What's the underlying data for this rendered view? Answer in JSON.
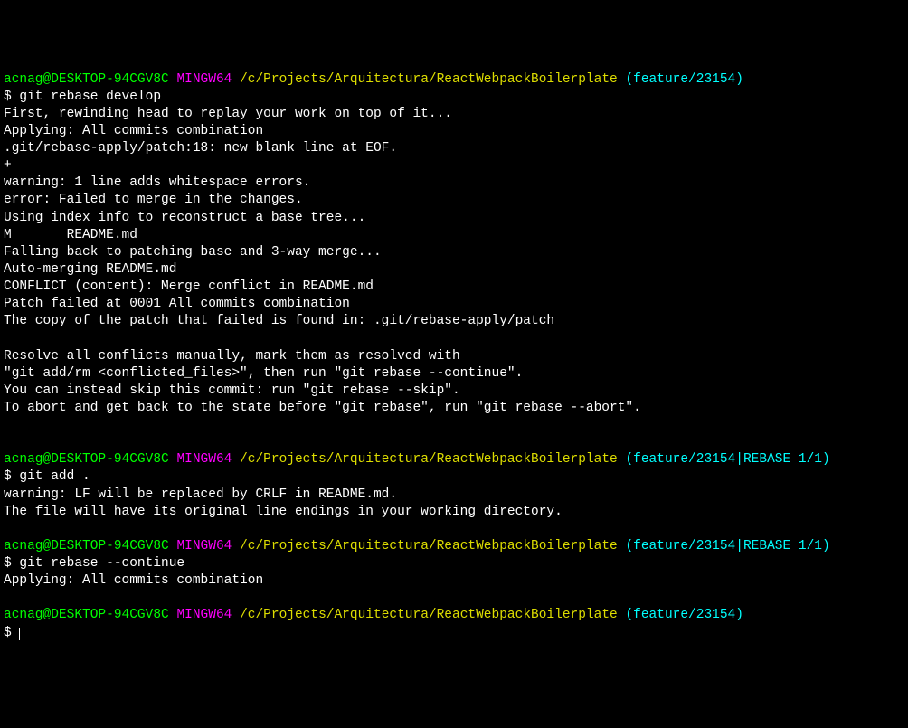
{
  "blocks": [
    {
      "prompt": {
        "userHost": "acnag@DESKTOP-94CGV8C",
        "mingw": "MINGW64",
        "path": "/c/Projects/Arquitectura/ReactWebpackBoilerplate",
        "branch": "(feature/23154)"
      },
      "command": "git rebase develop",
      "output": [
        "First, rewinding head to replay your work on top of it...",
        "Applying: All commits combination",
        ".git/rebase-apply/patch:18: new blank line at EOF.",
        "+",
        "warning: 1 line adds whitespace errors.",
        "error: Failed to merge in the changes.",
        "Using index info to reconstruct a base tree...",
        "M       README.md",
        "Falling back to patching base and 3-way merge...",
        "Auto-merging README.md",
        "CONFLICT (content): Merge conflict in README.md",
        "Patch failed at 0001 All commits combination",
        "The copy of the patch that failed is found in: .git/rebase-apply/patch",
        "",
        "Resolve all conflicts manually, mark them as resolved with",
        "\"git add/rm <conflicted_files>\", then run \"git rebase --continue\".",
        "You can instead skip this commit: run \"git rebase --skip\".",
        "To abort and get back to the state before \"git rebase\", run \"git rebase --abort\".",
        "",
        ""
      ]
    },
    {
      "prompt": {
        "userHost": "acnag@DESKTOP-94CGV8C",
        "mingw": "MINGW64",
        "path": "/c/Projects/Arquitectura/ReactWebpackBoilerplate",
        "branch": "(feature/23154|REBASE 1/1)"
      },
      "command": "git add .",
      "output": [
        "warning: LF will be replaced by CRLF in README.md.",
        "The file will have its original line endings in your working directory.",
        ""
      ]
    },
    {
      "prompt": {
        "userHost": "acnag@DESKTOP-94CGV8C",
        "mingw": "MINGW64",
        "path": "/c/Projects/Arquitectura/ReactWebpackBoilerplate",
        "branch": "(feature/23154|REBASE 1/1)"
      },
      "command": "git rebase --continue",
      "output": [
        "Applying: All commits combination",
        ""
      ]
    },
    {
      "prompt": {
        "userHost": "acnag@DESKTOP-94CGV8C",
        "mingw": "MINGW64",
        "path": "/c/Projects/Arquitectura/ReactWebpackBoilerplate",
        "branch": "(feature/23154)"
      },
      "command": "",
      "cursor": true,
      "output": []
    }
  ],
  "promptSymbol": "$ "
}
